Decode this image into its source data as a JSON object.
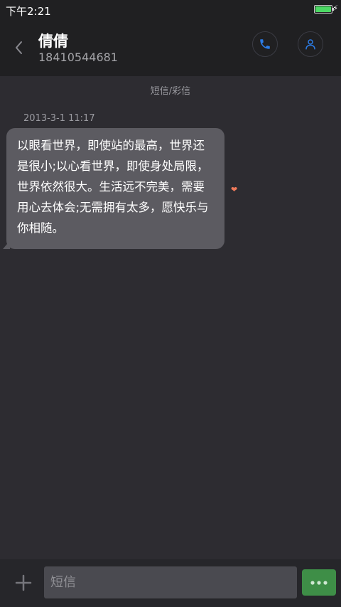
{
  "status_bar": {
    "time": "下午2:21",
    "battery_level": 1.0
  },
  "header": {
    "contact_name": "倩倩",
    "phone_number": "18410544681",
    "icons": [
      "back-arrow-icon",
      "phone-icon",
      "person-icon"
    ]
  },
  "conversation": {
    "section_label": "短信/彩信",
    "messages": [
      {
        "timestamp": "2013-3-1 11:17",
        "text": "以眼看世界，即使站的最高，世界还是很小;以心看世界，即使身处局限，世界依然很大。生活远不完美，需要用心去体会;无需拥有太多，愿快乐与你相随。",
        "heart_icon": "heart-icon"
      }
    ]
  },
  "composer": {
    "placeholder": "短信",
    "value": "",
    "icons": [
      "plus-icon",
      "more-dots-icon"
    ]
  },
  "colors": {
    "background": "#2d2c31",
    "header": "#202022",
    "bubble": "#5c5b61",
    "accent_blue": "#2b7de9",
    "send_green": "#3e8e47",
    "heart": "#f07a5a",
    "battery_green": "#4cd964"
  }
}
